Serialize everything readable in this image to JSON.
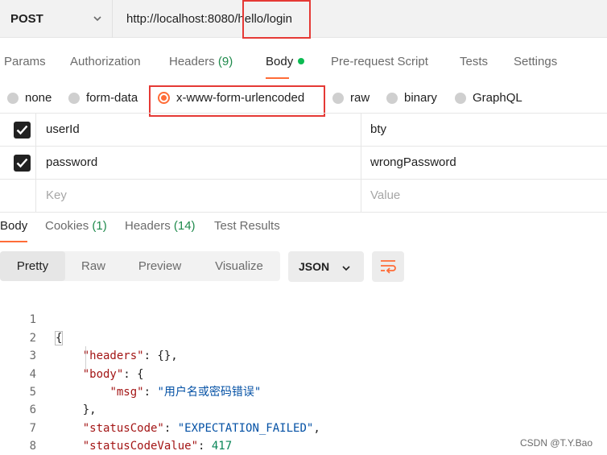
{
  "request": {
    "method": "POST",
    "url": "http://localhost:8080/hello/login"
  },
  "request_tabs": [
    {
      "label": "Params",
      "count": ""
    },
    {
      "label": "Authorization",
      "count": ""
    },
    {
      "label": "Headers",
      "count": "(9)"
    },
    {
      "label": "Body",
      "count": ""
    },
    {
      "label": "Pre-request Script",
      "count": ""
    },
    {
      "label": "Tests",
      "count": ""
    },
    {
      "label": "Settings",
      "count": ""
    }
  ],
  "active_request_tab": "Body",
  "body_types": [
    {
      "label": "none",
      "selected": false
    },
    {
      "label": "form-data",
      "selected": false
    },
    {
      "label": "x-www-form-urlencoded",
      "selected": true
    },
    {
      "label": "raw",
      "selected": false
    },
    {
      "label": "binary",
      "selected": false
    },
    {
      "label": "GraphQL",
      "selected": false
    }
  ],
  "params": [
    {
      "key": "userId",
      "value": "bty",
      "checked": true
    },
    {
      "key": "password",
      "value": "wrongPassword",
      "checked": true
    }
  ],
  "params_placeholder": {
    "key": "Key",
    "value": "Value"
  },
  "response_tabs": [
    {
      "label": "Body",
      "count": ""
    },
    {
      "label": "Cookies",
      "count": "(1)"
    },
    {
      "label": "Headers",
      "count": "(14)"
    },
    {
      "label": "Test Results",
      "count": ""
    }
  ],
  "format_buttons": [
    "Pretty",
    "Raw",
    "Preview",
    "Visualize"
  ],
  "active_format": "Pretty",
  "language": "JSON",
  "wrap_icon": "wrap-lines-icon",
  "code_lines": [
    {
      "n": "1",
      "key": "",
      "value": "",
      "punct": "{"
    },
    {
      "n": "2",
      "key": "\"headers\"",
      "value": "",
      "punct": ": {},"
    },
    {
      "n": "3",
      "key": "\"body\"",
      "value": "",
      "punct": ": {"
    },
    {
      "n": "4",
      "key": "\"msg\"",
      "value": "\"用户名或密码错误\"",
      "punct": ": "
    },
    {
      "n": "5",
      "key": "",
      "value": "",
      "punct": "},"
    },
    {
      "n": "6",
      "key": "\"statusCode\"",
      "value": "\"EXPECTATION_FAILED\"",
      "punct": ": "
    },
    {
      "n": "7",
      "key": "\"statusCodeValue\"",
      "value": "417",
      "punct": ": "
    },
    {
      "n": "8",
      "key": "",
      "value": "",
      "punct": "}"
    }
  ],
  "watermark": "CSDN @T.Y.Bao",
  "colors": {
    "accent": "#ff6c37",
    "highlight_box": "#e53935",
    "count_green": "#1f8a4c",
    "json_key": "#a31515",
    "json_string": "#0451a5",
    "json_number": "#098658"
  }
}
